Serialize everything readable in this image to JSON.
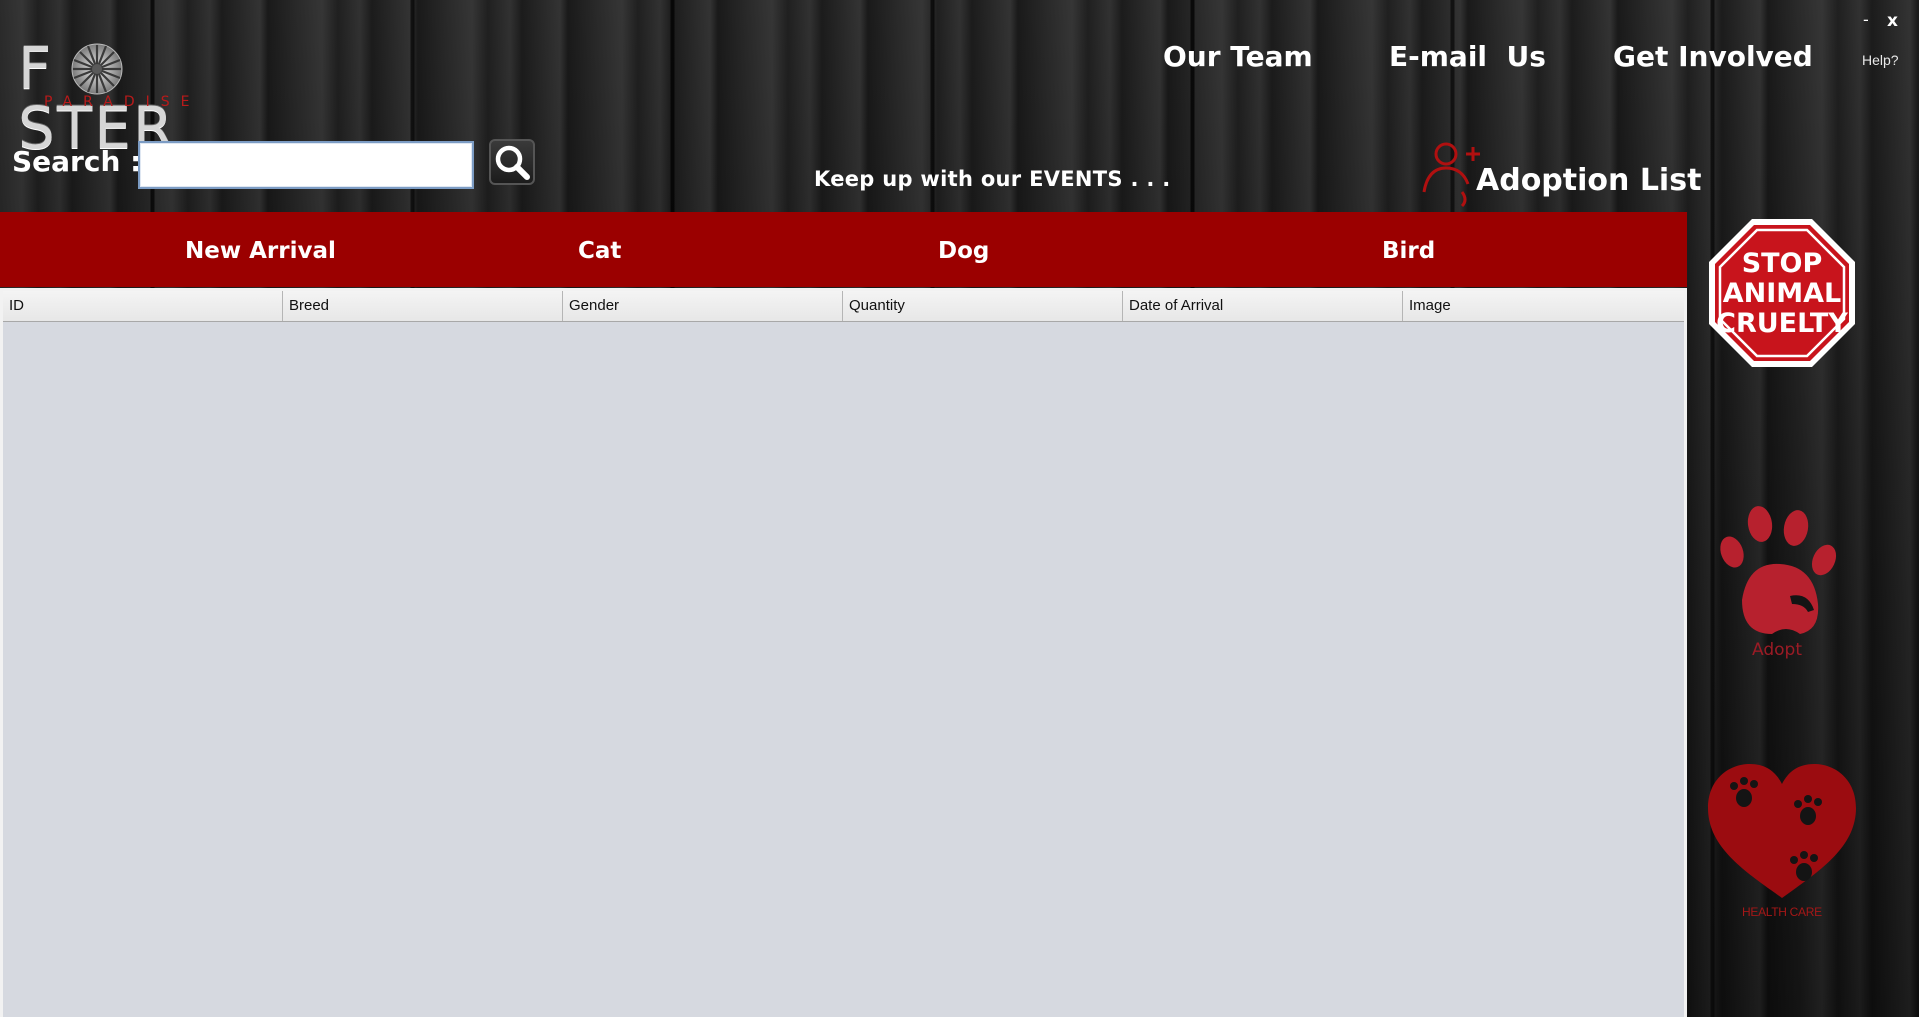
{
  "brand": {
    "name": "FOSTER",
    "name_left": "F",
    "name_right": "STER",
    "sub": "PARADISE"
  },
  "window": {
    "minimize": "-",
    "close": "x",
    "help": "Help?"
  },
  "nav": {
    "team": "Our Team",
    "email": "E-mail  Us",
    "involved": "Get Involved"
  },
  "search": {
    "label": "Search :",
    "value": "",
    "button_icon": "search-icon"
  },
  "events_text": "Keep up with our EVENTS . . .",
  "adoption": {
    "label": "Adoption List",
    "icon": "add-user-icon"
  },
  "categories": [
    "New Arrival",
    "Cat",
    "Dog",
    "Bird"
  ],
  "table": {
    "columns": [
      "ID",
      "Breed",
      "Gender",
      "Quantity",
      "Date of Arrival",
      "Image"
    ],
    "rows": []
  },
  "side": {
    "stop_sign": "STOP ANIMAL CRUELTY",
    "stop_lines": [
      "STOP",
      "ANIMAL",
      "CRUELTY"
    ],
    "adopt": "Adopt",
    "health": "HEALTH CARE"
  },
  "colors": {
    "accent": "#9b0000",
    "table_bg": "#d6d9e0",
    "logo_red": "#b81a1a"
  }
}
